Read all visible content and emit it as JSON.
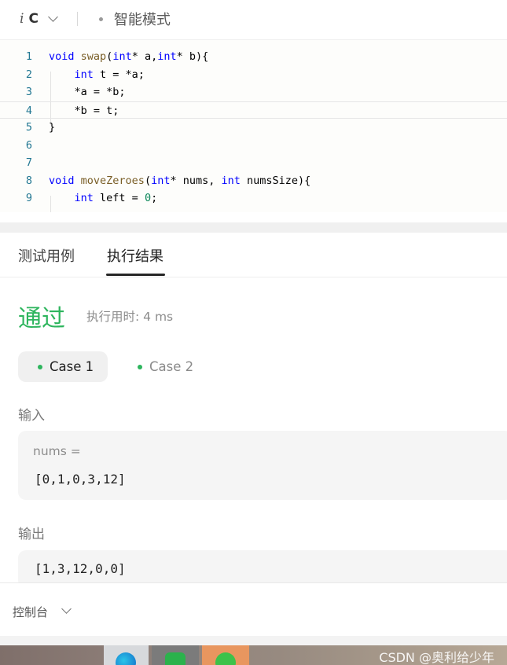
{
  "header": {
    "lang_icon": "i",
    "language": "C",
    "mode_label": "智能模式"
  },
  "editor": {
    "lines": [
      {
        "n": "1",
        "code": [
          {
            "t": "void",
            "c": "kw"
          },
          {
            "t": " "
          },
          {
            "t": "swap",
            "c": "fn"
          },
          {
            "t": "("
          },
          {
            "t": "int",
            "c": "kw"
          },
          {
            "t": "* a,"
          },
          {
            "t": "int",
            "c": "kw"
          },
          {
            "t": "* b){"
          }
        ]
      },
      {
        "n": "2",
        "code": [
          {
            "t": "    "
          },
          {
            "t": "int",
            "c": "kw"
          },
          {
            "t": " t = *a;"
          }
        ]
      },
      {
        "n": "3",
        "code": [
          {
            "t": "    *a = *b;"
          }
        ]
      },
      {
        "n": "4",
        "code": [
          {
            "t": "    *b = t;"
          }
        ],
        "current": true
      },
      {
        "n": "5",
        "code": [
          {
            "t": "}"
          }
        ]
      },
      {
        "n": "6",
        "code": []
      },
      {
        "n": "7",
        "code": []
      },
      {
        "n": "8",
        "code": [
          {
            "t": "void",
            "c": "kw"
          },
          {
            "t": " "
          },
          {
            "t": "moveZeroes",
            "c": "fn"
          },
          {
            "t": "("
          },
          {
            "t": "int",
            "c": "kw"
          },
          {
            "t": "* nums, "
          },
          {
            "t": "int",
            "c": "kw"
          },
          {
            "t": " numsSize){"
          }
        ]
      },
      {
        "n": "9",
        "code": [
          {
            "t": "    "
          },
          {
            "t": "int",
            "c": "kw"
          },
          {
            "t": " left = "
          },
          {
            "t": "0",
            "c": "num"
          },
          {
            "t": ";"
          }
        ]
      }
    ]
  },
  "tabs": {
    "testcases": "测试用例",
    "result": "执行结果"
  },
  "result": {
    "status": "通过",
    "runtime": "执行用时: 4 ms",
    "cases": [
      "Case 1",
      "Case 2"
    ],
    "input_label": "输入",
    "input_name": "nums =",
    "input_value": "[0,1,0,3,12]",
    "output_label": "输出",
    "output_value": "[1,3,12,0,0]"
  },
  "console": {
    "label": "控制台"
  },
  "watermark": "CSDN @奥利给少年",
  "colors": {
    "keyword": "#0000ff",
    "function": "#795e26",
    "number": "#098658",
    "line_number": "#237893",
    "accepted": "#2db55d"
  },
  "icons": [
    "italic-i-icon",
    "chevron-down-icon",
    "dot-icon",
    "edge-browser-icon",
    "app-icon",
    "wechat-icon"
  ]
}
